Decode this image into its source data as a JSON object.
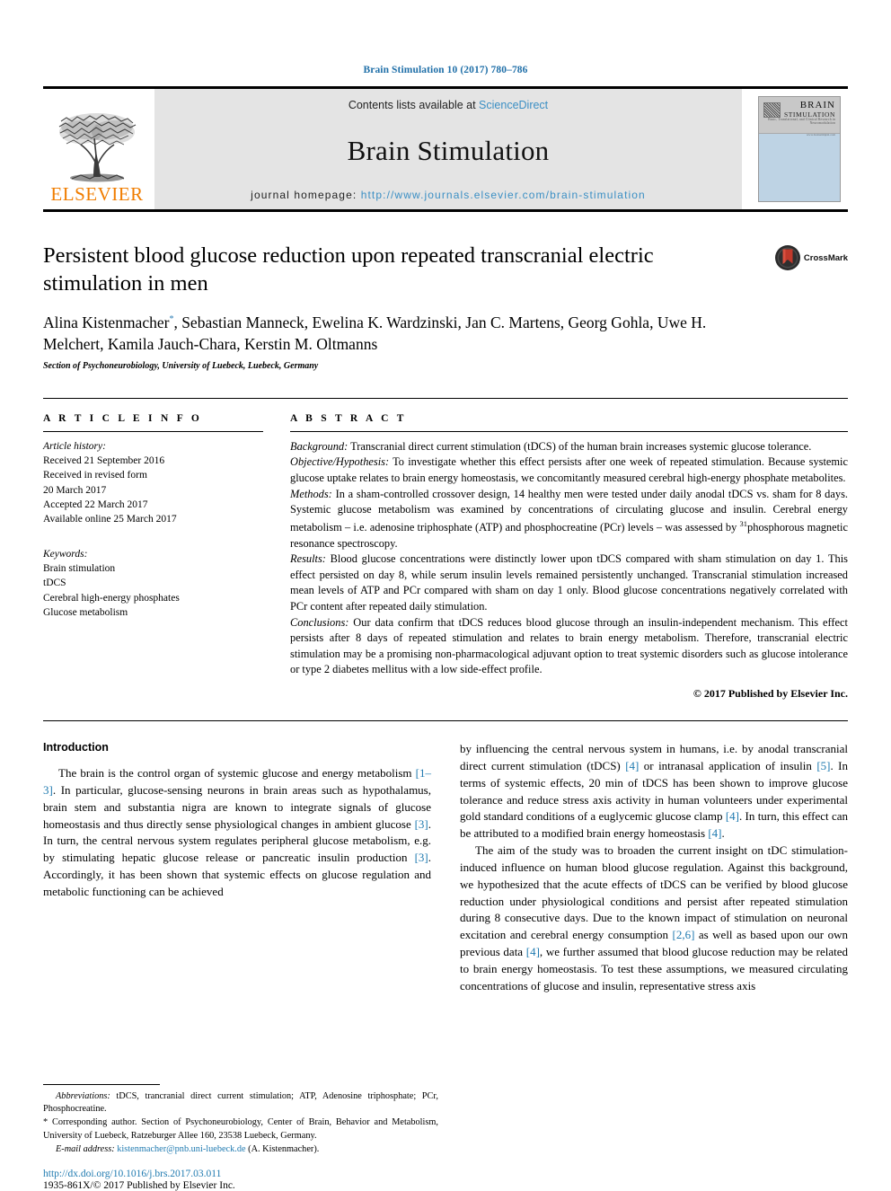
{
  "running_head": "Brain Stimulation 10 (2017) 780–786",
  "masthead": {
    "publisher_name": "ELSEVIER",
    "contents_prefix": "Contents lists available at ",
    "contents_link": "ScienceDirect",
    "journal_name": "Brain Stimulation",
    "homepage_prefix": "journal homepage: ",
    "homepage_url": "http://www.journals.elsevier.com/brain-stimulation",
    "cover": {
      "line1": "BRAIN",
      "line2": "STIMULATION",
      "line3": "Basic, Translational, and Clinical Research in Neuromodulation",
      "line4": "www.brainstimjrnl.com"
    }
  },
  "article": {
    "title": "Persistent blood glucose reduction upon repeated transcranial electric stimulation in men",
    "authors": "Alina Kistenmacher, Sebastian Manneck, Ewelina K. Wardzinski, Jan C. Martens, Georg Gohla, Uwe H. Melchert, Kamila Jauch-Chara, Kerstin M. Oltmanns",
    "corresponding_marker": "*",
    "affiliation": "Section of Psychoneurobiology, University of Luebeck, Luebeck, Germany",
    "crossmark_label": "CrossMark"
  },
  "article_info": {
    "heading": "A R T I C L E  I N F O",
    "history_label": "Article history:",
    "history": [
      "Received 21 September 2016",
      "Received in revised form",
      "20 March 2017",
      "Accepted 22 March 2017",
      "Available online 25 March 2017"
    ],
    "keywords_label": "Keywords:",
    "keywords": [
      "Brain stimulation",
      "tDCS",
      "Cerebral high-energy phosphates",
      "Glucose metabolism"
    ]
  },
  "abstract": {
    "heading": "A B S T R A C T",
    "background_label": "Background:",
    "background_text": " Transcranial direct current stimulation (tDCS) of the human brain increases systemic glucose tolerance.",
    "objective_label": "Objective/Hypothesis:",
    "objective_text": " To investigate whether this effect persists after one week of repeated stimulation. Because systemic glucose uptake relates to brain energy homeostasis, we concomitantly measured cerebral high-energy phosphate metabolites.",
    "methods_label": "Methods:",
    "methods_text_a": " In a sham-controlled crossover design, 14 healthy men were tested under daily anodal tDCS vs. sham for 8 days. Systemic glucose metabolism was examined by concentrations of circulating glucose and insulin. Cerebral energy metabolism – i.e. adenosine triphosphate (ATP) and phosphocreatine (PCr) levels – was assessed by ",
    "methods_sup": "31",
    "methods_text_b": "phosphorous magnetic resonance spectroscopy.",
    "results_label": "Results:",
    "results_text": " Blood glucose concentrations were distinctly lower upon tDCS compared with sham stimulation on day 1. This effect persisted on day 8, while serum insulin levels remained persistently unchanged. Transcranial stimulation increased mean levels of ATP and PCr compared with sham on day 1 only. Blood glucose concentrations negatively correlated with PCr content after repeated daily stimulation.",
    "conclusions_label": "Conclusions:",
    "conclusions_text": " Our data confirm that tDCS reduces blood glucose through an insulin-independent mechanism. This effect persists after 8 days of repeated stimulation and relates to brain energy metabolism. Therefore, transcranial electric stimulation may be a promising non-pharmacological adjuvant option to treat systemic disorders such as glucose intolerance or type 2 diabetes mellitus with a low side-effect profile.",
    "copyright": "© 2017 Published by Elsevier Inc."
  },
  "introduction": {
    "heading": "Introduction",
    "para1_a": "The brain is the control organ of systemic glucose and energy metabolism ",
    "para1_ref1": "[1–3]",
    "para1_b": ". In particular, glucose-sensing neurons in brain areas such as hypothalamus, brain stem and substantia nigra are known to integrate signals of glucose homeostasis and thus directly sense physiological changes in ambient glucose ",
    "para1_ref2": "[3]",
    "para1_c": ". In turn, the central nervous system regulates peripheral glucose metabolism, e.g. by stimulating hepatic glucose release or pancreatic insulin production ",
    "para1_ref3": "[3]",
    "para1_d": ". Accordingly, it has been shown that systemic effects on glucose regulation and metabolic functioning can be achieved",
    "para2_a": "by influencing the central nervous system in humans, i.e. by anodal transcranial direct current stimulation (tDCS) ",
    "para2_ref1": "[4]",
    "para2_b": " or intranasal application of insulin ",
    "para2_ref2": "[5]",
    "para2_c": ". In terms of systemic effects, 20 min of tDCS has been shown to improve glucose tolerance and reduce stress axis activity in human volunteers under experimental gold standard conditions of a euglycemic glucose clamp ",
    "para2_ref3": "[4]",
    "para2_d": ". In turn, this effect can be attributed to a modified brain energy homeostasis ",
    "para2_ref4": "[4]",
    "para2_e": ".",
    "para3_a": "The aim of the study was to broaden the current insight on tDC stimulation-induced influence on human blood glucose regulation. Against this background, we hypothesized that the acute effects of tDCS can be verified by blood glucose reduction under physiological conditions and persist after repeated stimulation during 8 consecutive days. Due to the known impact of stimulation on neuronal excitation and cerebral energy consumption ",
    "para3_ref1": "[2,6]",
    "para3_b": " as well as based upon our own previous data ",
    "para3_ref2": "[4]",
    "para3_c": ", we further assumed that blood glucose reduction may be related to brain energy homeostasis. To test these assumptions, we measured circulating concentrations of glucose and insulin, representative stress axis"
  },
  "footnotes": {
    "abbrev_label": "Abbreviations:",
    "abbrev_text": " tDCS, trancranial direct current stimulation; ATP, Adenosine triphosphate; PCr, Phosphocreatine.",
    "corresponding_marker": "*",
    "corresponding_text": " Corresponding author. Section of Psychoneurobiology, Center of Brain, Behavior and Metabolism, University of Luebeck, Ratzeburger Allee 160, 23538 Luebeck, Germany.",
    "email_label": "E-mail address:",
    "email_link": "kistenmacher@pnb.uni-luebeck.de",
    "email_suffix": " (A. Kistenmacher).",
    "doi_url": "http://dx.doi.org/10.1016/j.brs.2017.03.011",
    "issn_line": "1935-861X/© 2017 Published by Elsevier Inc."
  },
  "colors": {
    "link_blue": "#1f7ab0",
    "elsevier_orange": "#f07d00",
    "band_grey": "#e4e4e4",
    "cover_blue": "#bed3e4"
  }
}
